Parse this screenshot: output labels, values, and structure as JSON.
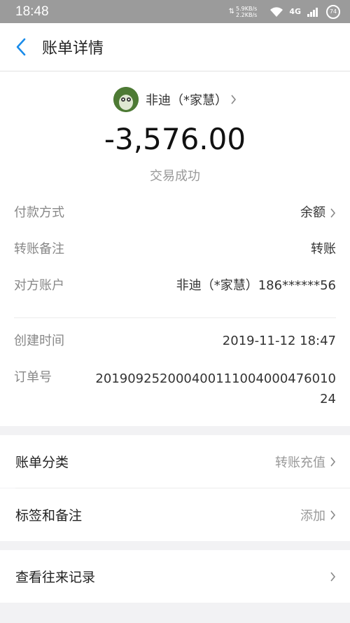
{
  "status_bar": {
    "time": "18:48",
    "net_up": "5.9KB/s",
    "net_down": "2.2KB/s",
    "network": "4G",
    "battery": "74"
  },
  "nav": {
    "title": "账单详情"
  },
  "hero": {
    "payee": "非迪（*家慧）",
    "amount": "-3,576.00",
    "status": "交易成功"
  },
  "details": [
    {
      "label": "付款方式",
      "value": "余额",
      "chevron": true
    },
    {
      "label": "转账备注",
      "value": "转账",
      "chevron": false
    },
    {
      "label": "对方账户",
      "value": "非迪（*家慧）186******56",
      "chevron": false
    }
  ],
  "meta": {
    "created_label": "创建时间",
    "created_value": "2019-11-12 18:47",
    "order_label": "订单号",
    "order_value": "20190925200040011100400047601024"
  },
  "sections": {
    "category_label": "账单分类",
    "category_value": "转账充值",
    "tags_label": "标签和备注",
    "tags_value": "添加",
    "history_label": "查看往来记录"
  }
}
